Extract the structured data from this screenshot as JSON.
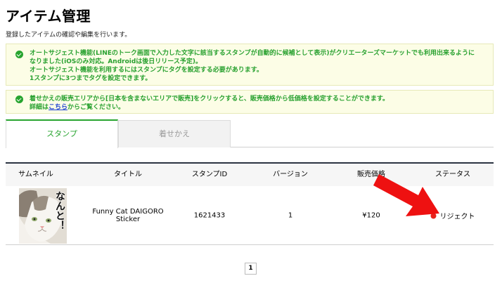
{
  "header": {
    "title": "アイテム管理",
    "subtitle": "登録したアイテムの確認や編集を行います。"
  },
  "notices": [
    {
      "lines": [
        "オートサジェスト機能(LINEのトーク画面で入力した文字に該当するスタンプが自動的に候補として表示)がクリエーターズマーケットでも利用出来るように",
        "なりました(iOSのみ対応。Androidは後日リリース予定)。",
        "オートサジェスト機能を利用するにはスタンプにタグを設定する必要があります。",
        "1スタンプに3つまでタグを設定できます。"
      ]
    },
    {
      "line1": "着せかえの販売エリアから[日本を含まないエリアで販売]をクリックすると、販売価格から低価格を設定することができます。",
      "line2_prefix": "詳細は",
      "line2_link": "こちら",
      "line2_suffix": "からご覧ください。"
    }
  ],
  "tabs": [
    {
      "label": "スタンプ",
      "active": true
    },
    {
      "label": "着せかえ",
      "active": false
    }
  ],
  "table": {
    "columns": [
      "サムネイル",
      "タイトル",
      "スタンプID",
      "バージョン",
      "販売価格",
      "ステータス"
    ],
    "rows": [
      {
        "thumbnail_icon": "cat-sticker-thumbnail",
        "thumbnail_text": "なんと！",
        "title": "Funny Cat DAIGORO Sticker",
        "stamp_id": "1621433",
        "version": "1",
        "price": "¥120",
        "status": "リジェクト",
        "status_color": "#e8231c"
      }
    ]
  },
  "pagination": {
    "current": "1"
  },
  "colors": {
    "accent": "#27a42f",
    "notice_bg": "#fcfde6",
    "arrow": "#ee1111"
  }
}
